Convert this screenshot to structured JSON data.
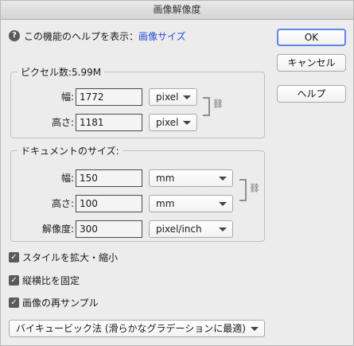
{
  "window": {
    "title": "画像解像度"
  },
  "help": {
    "prefix": "この機能のヘルプを表示：",
    "link": "画像サイズ",
    "icon": "?"
  },
  "buttons": {
    "ok": "OK",
    "cancel": "キャンセル",
    "help": "ヘルプ"
  },
  "pixel_group": {
    "label": "ピクセル数:5.99M",
    "width": {
      "label": "幅:",
      "value": "1772",
      "unit": "pixel"
    },
    "height": {
      "label": "高さ:",
      "value": "1181",
      "unit": "pixel"
    }
  },
  "doc_group": {
    "label": "ドキュメントのサイズ:",
    "width": {
      "label": "幅:",
      "value": "150",
      "unit": "mm"
    },
    "height": {
      "label": "高さ:",
      "value": "100",
      "unit": "mm"
    },
    "resolution": {
      "label": "解像度:",
      "value": "300",
      "unit": "pixel/inch"
    }
  },
  "options": {
    "scale_styles": {
      "label": "スタイルを拡大・縮小",
      "checked": true
    },
    "constrain": {
      "label": "縦横比を固定",
      "checked": true
    },
    "resample": {
      "label": "画像の再サンプル",
      "checked": true
    }
  },
  "resample_method": "バイキュービック法 (滑らかなグラデーションに最適)",
  "icons": {
    "link": "chain-link-icon",
    "caret": "chevron-down-icon",
    "check": "✓"
  }
}
